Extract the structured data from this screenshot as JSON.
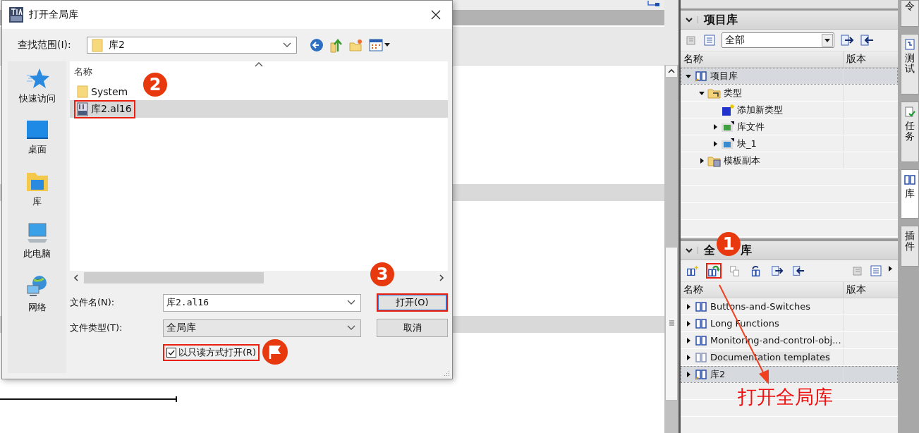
{
  "project_library": {
    "title": "项目库",
    "filter": "全部",
    "columns": [
      "名称",
      "版本"
    ],
    "tree": [
      {
        "label": "项目库",
        "kind": "library-edit",
        "expanded": true,
        "selected": true,
        "children": [
          {
            "label": "类型",
            "kind": "folder-types",
            "expanded": true,
            "selected": false,
            "children": [
              {
                "label": "添加新类型",
                "kind": "add",
                "selected": false
              },
              {
                "label": "库文件",
                "kind": "type-green",
                "expanded": false,
                "selected": false
              },
              {
                "label": "块_1",
                "kind": "type-blue",
                "expanded": false,
                "selected": false
              }
            ]
          },
          {
            "label": "模板副本",
            "kind": "folder-copy",
            "expanded": false,
            "selected": false
          }
        ]
      }
    ]
  },
  "global_library": {
    "title": [
      "全",
      "库"
    ],
    "columns": [
      "名称",
      "版本"
    ],
    "toolbar": [
      {
        "kind": "new",
        "highlighted": false
      },
      {
        "kind": "open",
        "highlighted": true
      },
      {
        "kind": "copy",
        "highlighted": false
      },
      {
        "kind": "update",
        "highlighted": false
      },
      {
        "kind": "export",
        "highlighted": false
      },
      {
        "kind": "import",
        "highlighted": false
      }
    ],
    "items": [
      {
        "label": "Buttons-and-Switches",
        "kind": "library",
        "expanded": false,
        "selected": false
      },
      {
        "label": "Long Functions",
        "kind": "library",
        "expanded": false,
        "selected": false
      },
      {
        "label": "Monitoring-and-control-obj...",
        "kind": "library",
        "expanded": false,
        "selected": false
      },
      {
        "label": "Documentation templates",
        "kind": "library-grey",
        "expanded": false,
        "selected": false
      },
      {
        "label": "库2",
        "kind": "library-edit",
        "expanded": false,
        "selected": true
      }
    ]
  },
  "side_tabs": [
    {
      "label": "令",
      "selected": false
    },
    {
      "label": "测试",
      "selected": false
    },
    {
      "label": "任务",
      "selected": false
    },
    {
      "label": "库",
      "selected": true
    },
    {
      "label": "插件",
      "selected": false
    }
  ],
  "dialog": {
    "title": "打开全局库",
    "look_in_label": "查找范围(I):",
    "look_in": "库2",
    "places": [
      {
        "label": "快速访问",
        "kind": "star"
      },
      {
        "label": "桌面",
        "kind": "desktop"
      },
      {
        "label": "库",
        "kind": "library"
      },
      {
        "label": "此电脑",
        "kind": "computer"
      },
      {
        "label": "网络",
        "kind": "network"
      }
    ],
    "column": "名称",
    "files": [
      {
        "name": "System",
        "kind": "folder",
        "selected": false,
        "highlighted": false
      },
      {
        "name": "库2.al16",
        "kind": "library-file",
        "selected": true,
        "highlighted": true
      }
    ],
    "file_name_label": "文件名(N):",
    "file_name": "库2.al16",
    "file_type_label": "文件类型(T):",
    "file_type": "全局库",
    "read_only": {
      "label": "以只读方式打开(R)",
      "checked": true,
      "highlighted": true
    },
    "buttons": [
      {
        "label": "打开(O)",
        "highlighted": true
      },
      {
        "label": "取消",
        "highlighted": false
      }
    ]
  },
  "annotations": {
    "steps": [
      {
        "label": "1"
      },
      {
        "label": "2"
      },
      {
        "label": "3"
      }
    ],
    "caption": "打开全局库"
  }
}
